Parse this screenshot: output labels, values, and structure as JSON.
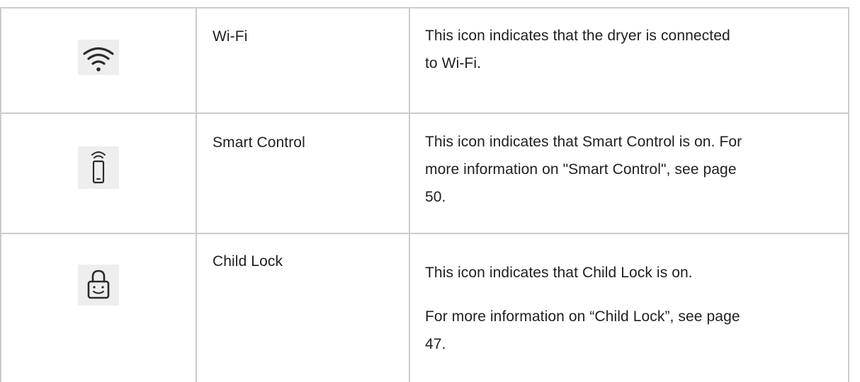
{
  "rows": [
    {
      "icon": "wifi-icon",
      "name": "Wi-Fi",
      "description": [
        "This icon indicates that the dryer is connected",
        "to Wi-Fi."
      ]
    },
    {
      "icon": "smart-control-icon",
      "name": "Smart Control",
      "description": [
        "This icon indicates that Smart Control is on. For",
        "more information on \"Smart Control\", see page",
        "50."
      ]
    },
    {
      "icon": "child-lock-icon",
      "name": "Child Lock",
      "description": [
        "This icon indicates that Child Lock is on."
      ],
      "description_extra": [
        "For more information on “Child Lock”, see page",
        "47."
      ]
    }
  ],
  "colors": {
    "border": "#cccccc",
    "text": "#1f1f1f",
    "icon_bg": "#eeeeee",
    "icon_fg": "#2a2a2a"
  }
}
